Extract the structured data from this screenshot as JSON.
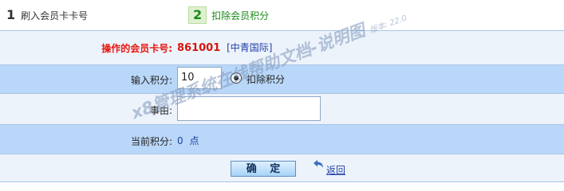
{
  "steps": [
    {
      "num": "1",
      "label": "刷入会员卡卡号"
    },
    {
      "num": "2",
      "label": "扣除会员积分"
    }
  ],
  "form": {
    "card_label": "操作的会员卡号:",
    "card_number": "861001",
    "card_org": "[中青国际]",
    "points_label": "输入积分:",
    "points_value": "10",
    "deduct_option_label": "扣除积分",
    "reason_label": "事由:",
    "reason_value": "",
    "current_points_label": "当前积分:",
    "current_points_value": "0",
    "current_points_unit": "点",
    "confirm_label": "确 定",
    "back_label": "返回"
  },
  "watermark": {
    "text": "x8管理系统在线帮助文档-说明图",
    "version": "版本: 22.0"
  },
  "colors": {
    "accent_red": "#e8170f",
    "link_blue": "#1f3fa6",
    "row_blue": "#b9d7f8",
    "row_light": "#edf3fb",
    "step_green": "#1a8a1a"
  }
}
